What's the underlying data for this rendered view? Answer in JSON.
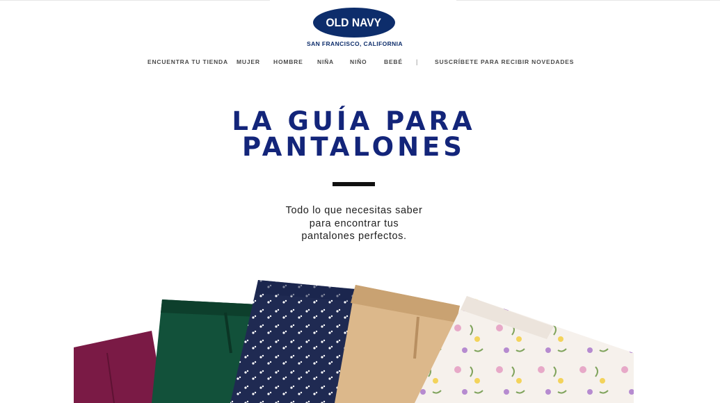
{
  "brand": {
    "logo_text": "OLD NAVY",
    "location": "SAN FRANCISCO, CALIFORNIA",
    "color": "#0d2d6b"
  },
  "nav": {
    "find_store": "ENCUENTRA TU TIENDA",
    "women": "MUJER",
    "men": "HOMBRE",
    "girls": "NIÑA",
    "boys": "NIÑO",
    "baby": "BEBÉ",
    "separator": "|",
    "subscribe": "SUSCRÍBETE PARA RECIBIR NOVEDADES"
  },
  "hero": {
    "title_line1": "LA GUÍA PARA",
    "title_line2": "PANTALONES",
    "subtitle_line1": "Todo lo que necesitas saber",
    "subtitle_line2": "para encontrar tus",
    "subtitle_line3": "pantalones perfectos.",
    "title_color": "#13257a"
  },
  "image": {
    "pant_colors": [
      "#7a1a45",
      "#12513a",
      "#1f2a52",
      "#dcb88b",
      "#f6f1ec"
    ],
    "description_icons": [
      "pants-burgundy",
      "pants-green",
      "pants-navy-print",
      "pants-khaki",
      "pants-floral"
    ]
  }
}
